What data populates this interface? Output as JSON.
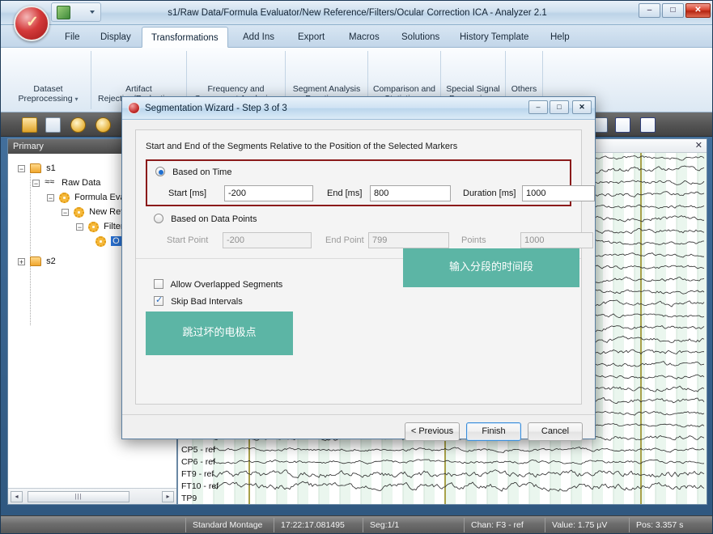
{
  "window": {
    "title": "s1/Raw Data/Formula Evaluator/New Reference/Filters/Ocular Correction ICA - Analyzer 2.1",
    "minimize": "–",
    "maximize": "□",
    "close": "✕",
    "orb_glyph": "✓"
  },
  "ribbon": {
    "tabs": [
      {
        "label": "File"
      },
      {
        "label": "Display"
      },
      {
        "label": "Transformations"
      },
      {
        "label": "Add Ins"
      },
      {
        "label": "Export"
      },
      {
        "label": "Macros"
      },
      {
        "label": "Solutions"
      },
      {
        "label": "History Template"
      },
      {
        "label": "Help"
      }
    ],
    "active_tab": "Transformations",
    "groups": [
      {
        "line1": "Dataset",
        "line2": "Preprocessing",
        "caret": "▾"
      },
      {
        "line1": "Artifact",
        "line2": "Rejection/Reduction",
        "caret": "▾"
      },
      {
        "line1": "Frequency and",
        "line2": "Component Analysis",
        "caret": "▾"
      },
      {
        "line1": "Segment Analysis",
        "line2": "Functions",
        "caret": "▾"
      },
      {
        "line1": "Comparison and",
        "line2": "Statistics",
        "caret": "▾"
      },
      {
        "line1": "Special Signal",
        "line2": "Processing",
        "caret": "▾"
      },
      {
        "line1": "Others",
        "line2": "",
        "caret": "▾"
      }
    ]
  },
  "toolbar": {
    "icons": [
      "save-icon",
      "chart-icon",
      "zoom-in-icon",
      "zoom-out-icon",
      "panel-left-icon",
      "panel-rows-icon",
      "panel-columns-icon"
    ]
  },
  "tree": {
    "header": "Primary",
    "nodes": [
      {
        "label": "s1",
        "icon": "folder-icon",
        "expander": "−",
        "indent": 0,
        "selected": false
      },
      {
        "label": "Raw Data",
        "icon": "waveform-icon",
        "expander": "−",
        "indent": 1,
        "selected": false
      },
      {
        "label": "Formula Eva",
        "icon": "gear-icon",
        "expander": "−",
        "indent": 2,
        "selected": false
      },
      {
        "label": "New Ref",
        "icon": "gear-icon",
        "expander": "−",
        "indent": 3,
        "selected": false
      },
      {
        "label": "Filter",
        "icon": "gear-icon",
        "expander": "−",
        "indent": 4,
        "selected": false
      },
      {
        "label": "O",
        "icon": "gear-icon",
        "expander": "",
        "indent": 5,
        "selected": true
      },
      {
        "label": "s2",
        "icon": "folder-icon",
        "expander": "+",
        "indent": 0,
        "selected": false
      }
    ],
    "scroll_left": "◂",
    "scroll_right": "▸",
    "scroll_grip": "⫿ffff"
  },
  "eeg": {
    "close_glyph": "✕",
    "channels": [
      "CP5 - ref",
      "CP6 - ref",
      "FT9 - ref",
      "FT10 - ref",
      "TP9"
    ]
  },
  "statusbar": {
    "cells": [
      "Standard Montage",
      "17:22:17.081495",
      "Seg:1/1",
      "Chan:  F3 - ref",
      "Value: 1.75 µV",
      "Pos:  3.357 s"
    ]
  },
  "dialog": {
    "title": "Segmentation Wizard - Step 3 of 3",
    "minimize": "–",
    "maximize": "□",
    "close": "✕",
    "group_caption": "Start and End of the Segments Relative to the Position of the Selected Markers",
    "time": {
      "radio_label": "Based on Time",
      "selected": true,
      "fields": [
        {
          "label": "Start [ms]",
          "value": "-200"
        },
        {
          "label": "End [ms]",
          "value": "800"
        },
        {
          "label": "Duration [ms]",
          "value": "1000"
        }
      ]
    },
    "datapoints": {
      "radio_label": "Based on Data Points",
      "selected": false,
      "fields": [
        {
          "label": "Start Point",
          "value": "-200"
        },
        {
          "label": "End Point",
          "value": "799"
        },
        {
          "label": "Points",
          "value": "1000"
        }
      ]
    },
    "checkboxes": [
      {
        "label": "Allow Overlapped Segments",
        "checked": false
      },
      {
        "label": "Skip Bad Intervals",
        "checked": true
      }
    ],
    "notes": [
      {
        "text": "输入分段的时间段"
      },
      {
        "text": "跳过坏的电极点"
      }
    ],
    "buttons": [
      {
        "label": "< Previous",
        "default": false
      },
      {
        "label": "Finish",
        "default": true
      },
      {
        "label": "Cancel",
        "default": false
      }
    ]
  },
  "colors": {
    "note_teal": "#5cb5a5",
    "highlight_red": "#8b1a1a",
    "selection_blue": "#2a72d4"
  }
}
